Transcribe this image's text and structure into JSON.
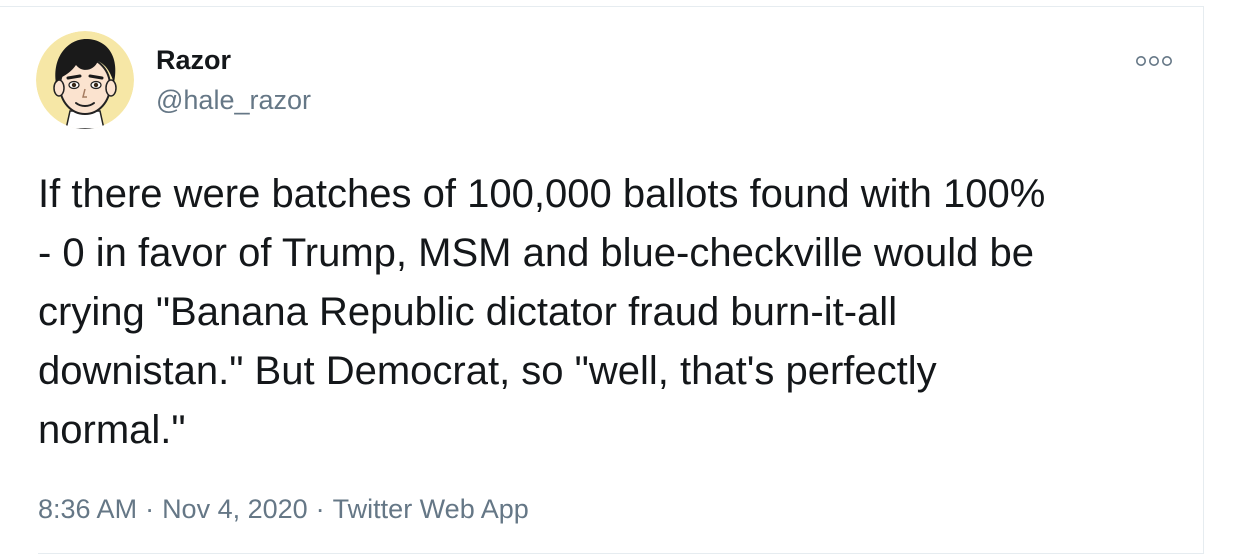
{
  "author": {
    "display_name": "Razor",
    "handle": "@hale_razor",
    "avatar_icon": "cartoon-avatar-icon"
  },
  "tweet": {
    "text": "If there were batches of 100,000 ballots found with 100%\n- 0 in favor of Trump, MSM and blue-checkville would be\ncrying \"Banana Republic dictator fraud burn-it-all\ndownistan.\" But Democrat, so \"well, that's perfectly\nnormal.\""
  },
  "meta": {
    "time": "8:36 AM",
    "separator": "·",
    "date": "Nov 4, 2020",
    "source": "Twitter Web App"
  },
  "icons": {
    "more": "more-options-icon"
  },
  "colors": {
    "text_primary": "#14171a",
    "text_secondary": "#657786",
    "divider": "#e6ecf0"
  }
}
